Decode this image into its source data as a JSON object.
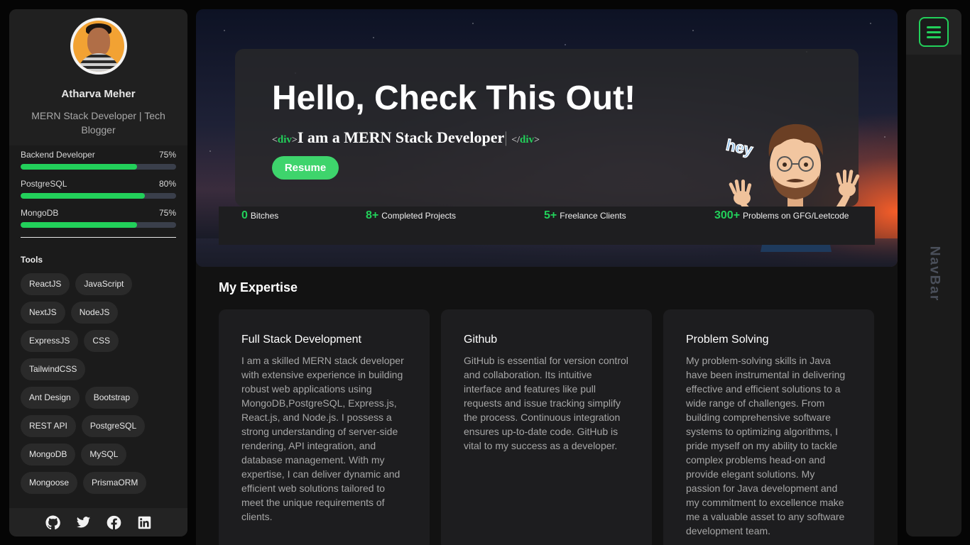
{
  "profile": {
    "name": "Atharva Meher",
    "role": "MERN Stack Developer | Tech Blogger"
  },
  "skills": [
    {
      "label": "Backend Developer",
      "percent_text": "75%",
      "level": 0.75
    },
    {
      "label": "PostgreSQL",
      "percent_text": "80%",
      "level": 0.8
    },
    {
      "label": "MongoDB",
      "percent_text": "75%",
      "level": 0.75
    }
  ],
  "tools": {
    "title": "Tools",
    "items": [
      "ReactJS",
      "JavaScript",
      "NextJS",
      "NodeJS",
      "ExpressJS",
      "CSS",
      "TailwindCSS",
      "Ant Design",
      "Bootstrap",
      "REST API",
      "PostgreSQL",
      "MongoDB",
      "MySQL",
      "Mongoose",
      "PrismaORM"
    ]
  },
  "socials": {
    "icons": [
      "github-icon",
      "twitter-icon",
      "facebook-icon",
      "linkedin-icon"
    ]
  },
  "hero": {
    "title": "Hello, Check This Out!",
    "tag_open_lt": "<",
    "tag_name": "div",
    "tag_gt": ">",
    "tag_close_lt": "</",
    "subtitle": "I am a MERN Stack Developer",
    "cursor": "|",
    "resume_label": "Resume",
    "memoji_text": "hey"
  },
  "stats": [
    {
      "number": "0",
      "label": "Bitches"
    },
    {
      "number": "8+",
      "label": "Completed Projects"
    },
    {
      "number": "5+",
      "label": "Freelance Clients"
    },
    {
      "number": "300+",
      "label": "Problems on GFG/Leetcode"
    }
  ],
  "expertise": {
    "title": "My Expertise",
    "cards": [
      {
        "title": "Full Stack Development",
        "body": "I am a skilled MERN stack developer with extensive experience in building robust web applications using MongoDB,PostgreSQL, Express.js, React.js, and Node.js. I possess a strong understanding of server-side rendering, API integration, and database management. With my expertise, I can deliver dynamic and efficient web solutions tailored to meet the unique requirements of clients."
      },
      {
        "title": "Github",
        "body": "GitHub is essential for version control and collaboration. Its intuitive interface and features like pull requests and issue tracking simplify the process. Continuous integration ensures up-to-date code. GitHub is vital to my success as a developer."
      },
      {
        "title": "Problem Solving",
        "body": "My problem-solving skills in Java have been instrumental in delivering effective and efficient solutions to a wide range of challenges. From building comprehensive software systems to optimizing algorithms, I pride myself on my ability to tackle complex problems head-on and provide elegant solutions. My passion for Java development and my commitment to excellence make me a valuable asset to any software development team."
      }
    ]
  },
  "rightnav": {
    "label": "NavBar",
    "menu_icon": "hamburger-menu-icon"
  },
  "colors": {
    "accent": "#22d05a",
    "sidebar_bg": "#1b1b1b",
    "page_bg": "#050505"
  }
}
